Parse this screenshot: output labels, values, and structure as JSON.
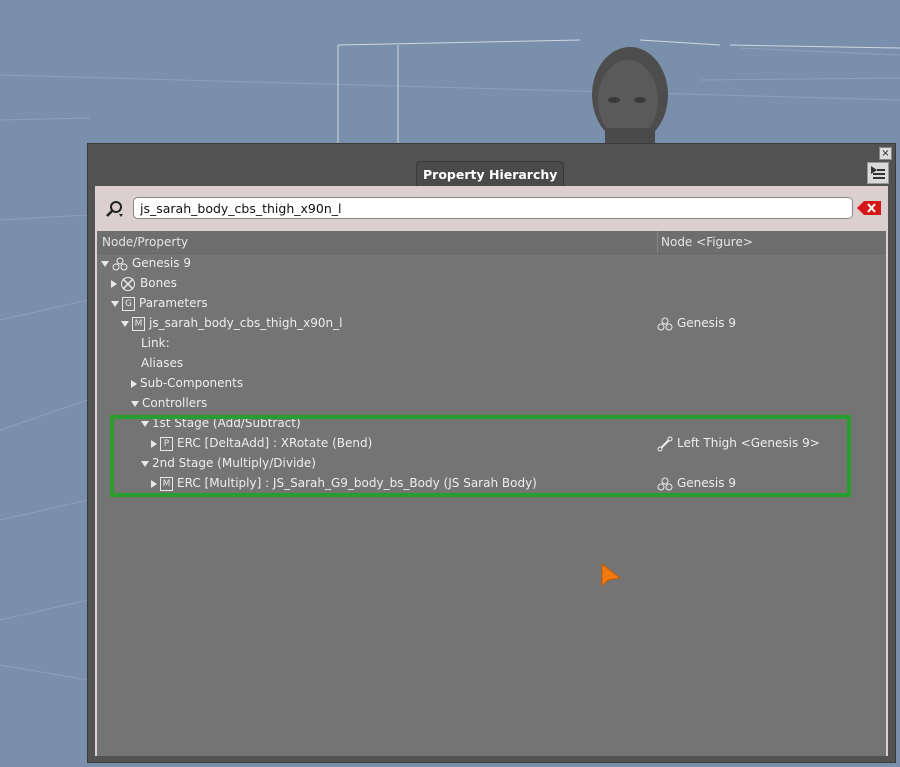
{
  "panel": {
    "title": "Property Hierarchy",
    "close_glyph": "×",
    "menu_icon": "panel-menu-icon"
  },
  "search": {
    "value": "js_sarah_body_cbs_thigh_x90n_l",
    "icon": "search-icon",
    "clear_icon": "clear-icon"
  },
  "columns": {
    "node_property": "Node/Property",
    "node_figure": "Node <Figure>"
  },
  "tree": {
    "genesis9": "Genesis 9",
    "bones": "Bones",
    "parameters": "Parameters",
    "morph": "js_sarah_body_cbs_thigh_x90n_l",
    "morph_node": "Genesis 9",
    "link": "Link:",
    "aliases": "Aliases",
    "subcomponents": "Sub-Components",
    "controllers": "Controllers",
    "stage1": "1st Stage (Add/Subtract)",
    "erc1": "ERC [DeltaAdd] : XRotate (Bend)",
    "erc1_node": "Left Thigh <Genesis 9>",
    "stage2": "2nd Stage (Multiply/Divide)",
    "erc2": "ERC [Multiply] : JS_Sarah_G9_body_bs_Body (JS Sarah Body)",
    "erc2_node": "Genesis 9",
    "icons": {
      "param_group": "G",
      "morph": "M",
      "property": "P"
    }
  },
  "colors": {
    "highlight": "#2a9e2a",
    "viewport_bg": "#7a8fab",
    "cursor": "#f07a10"
  }
}
